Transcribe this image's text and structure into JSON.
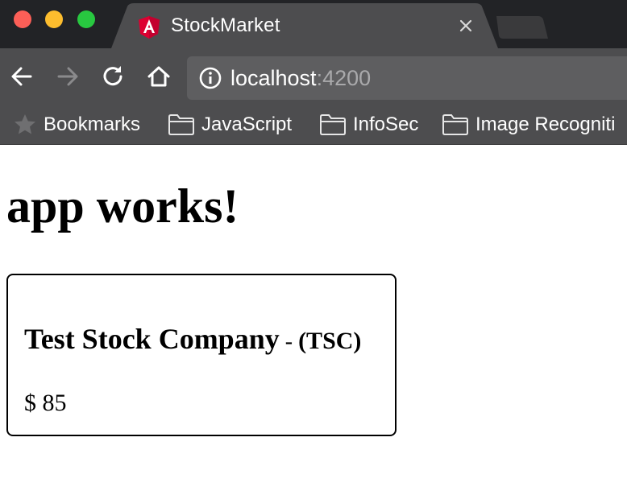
{
  "window": {
    "tab_title": "StockMarket"
  },
  "toolbar": {
    "url_host": "localhost",
    "url_port": ":4200"
  },
  "bookmarks": {
    "items": [
      {
        "label": "Bookmarks",
        "icon": "star-icon"
      },
      {
        "label": "JavaScript",
        "icon": "folder-icon"
      },
      {
        "label": "InfoSec",
        "icon": "folder-icon"
      },
      {
        "label": "Image Recogniti",
        "icon": "folder-icon"
      }
    ]
  },
  "page": {
    "heading": "app works!",
    "stock": {
      "name": "Test Stock Company",
      "separator": " - ",
      "code": "(TSC)",
      "price": "$ 85"
    }
  },
  "colors": {
    "titlebar": "#222326",
    "toolbar": "#4d4d4f",
    "omnibox": "#5e5e60",
    "angular_red": "#dd0031"
  }
}
